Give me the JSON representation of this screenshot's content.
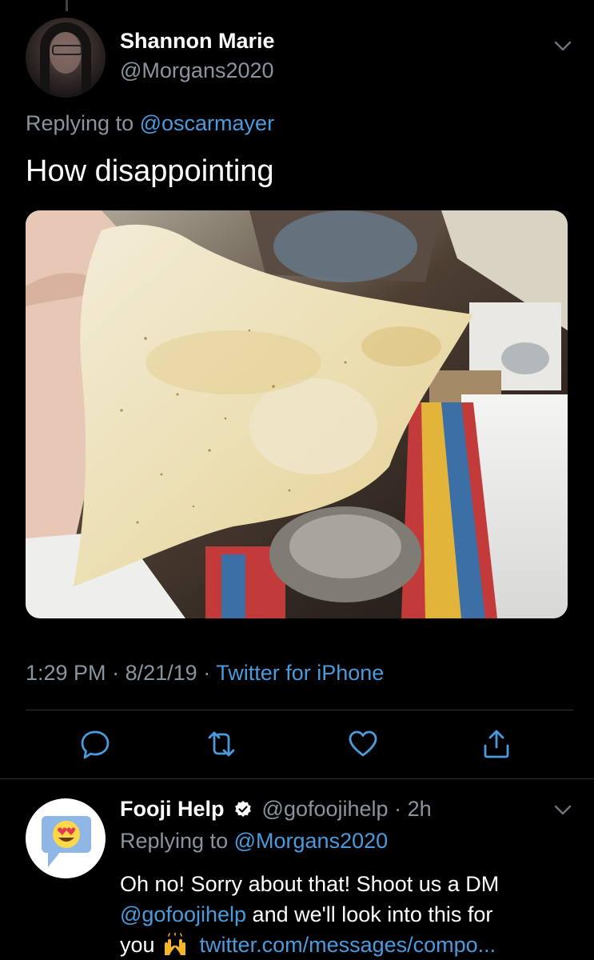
{
  "tweet": {
    "author_name": "Shannon Marie",
    "author_handle": "@Morgans2020",
    "replying_prefix": "Replying to",
    "replying_to": "@oscarmayer",
    "text": "How disappointing",
    "time": "1:29 PM",
    "date": "8/21/19",
    "source": "Twitter for iPhone",
    "separator": "·"
  },
  "reply": {
    "author_name": "Fooji Help",
    "author_handle": "@gofoojihelp",
    "age": "2h",
    "replying_prefix": "Replying to",
    "replying_to": "@Morgans2020",
    "text_part1": "Oh no! Sorry about that! Shoot us a DM",
    "mention": "@gofoojihelp",
    "text_part2": "and we'll look into this for",
    "text_part3": "you",
    "link": "twitter.com/messages/compo..."
  },
  "icons": {
    "reply": "reply-icon",
    "retweet": "retweet-icon",
    "like": "heart-icon",
    "share": "share-icon",
    "chevron": "chevron-down-icon",
    "verified": "verified-badge-icon"
  },
  "colors": {
    "background": "#000000",
    "text": "#ffffff",
    "secondary_text": "#8a949e",
    "link": "#4a9bdd",
    "divider": "#2f3336"
  }
}
